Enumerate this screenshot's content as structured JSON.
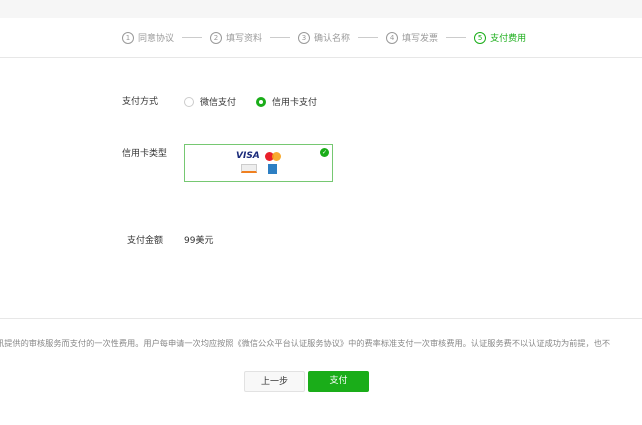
{
  "steps": [
    {
      "num": "1",
      "label": "同意协议"
    },
    {
      "num": "2",
      "label": "填写资料"
    },
    {
      "num": "3",
      "label": "确认名称"
    },
    {
      "num": "4",
      "label": "填写发票"
    },
    {
      "num": "5",
      "label": "支付费用"
    }
  ],
  "active_step": 5,
  "payment_method": {
    "label": "支付方式",
    "options": [
      "微信支付",
      "信用卡支付"
    ],
    "selected": "信用卡支付"
  },
  "card_type": {
    "label": "信用卡类型",
    "brands": [
      "VISA",
      "MasterCard",
      "Discover",
      "American Express"
    ]
  },
  "amount": {
    "label": "支付金额",
    "value": "99美元"
  },
  "note": "讯提供的审核服务而支付的一次性费用。用户每申请一次均应按照《微信公众平台认证服务协议》中的费率标准支付一次审核费用。认证服务费不以认证成功为前提，也不",
  "buttons": {
    "prev": "上一步",
    "pay": "支付"
  },
  "colors": {
    "accent": "#1aad19"
  }
}
